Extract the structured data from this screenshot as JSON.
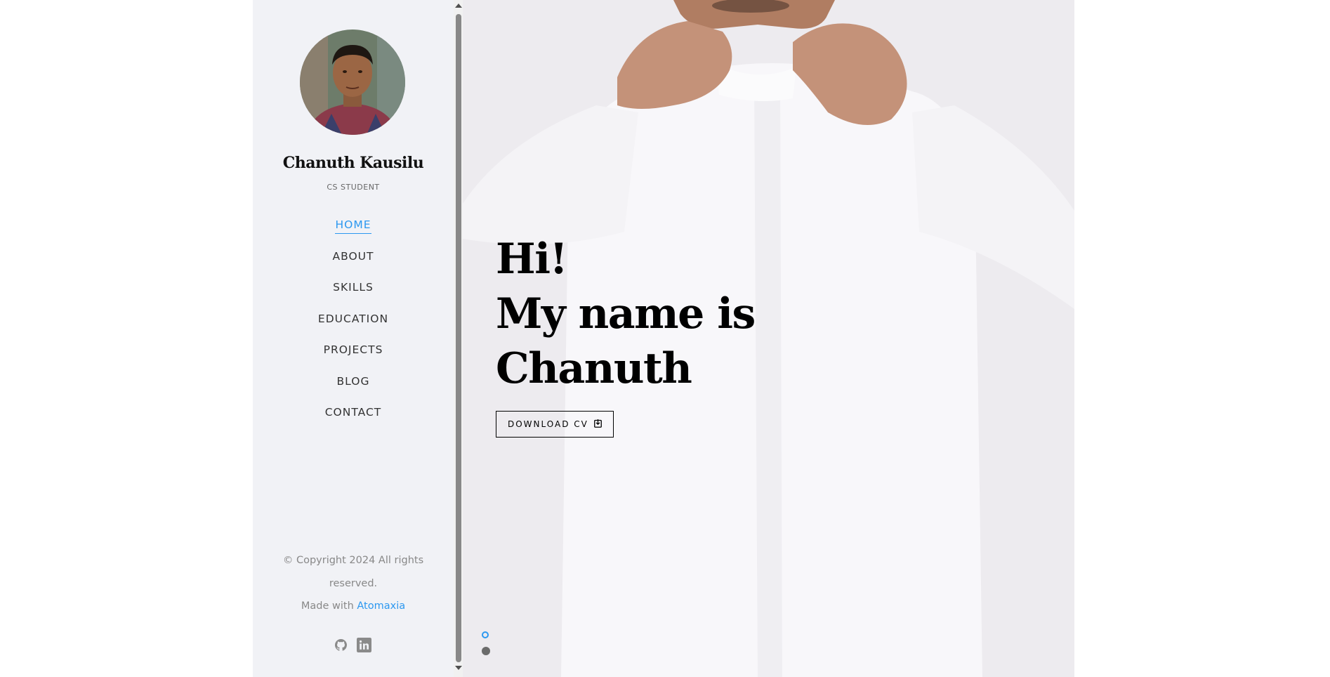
{
  "profile": {
    "name": "Chanuth Kausilu",
    "role": "CS STUDENT"
  },
  "nav": {
    "items": [
      {
        "label": "HOME",
        "active": true
      },
      {
        "label": "ABOUT"
      },
      {
        "label": "SKILLS"
      },
      {
        "label": "EDUCATION"
      },
      {
        "label": "PROJECTS"
      },
      {
        "label": "BLOG"
      },
      {
        "label": "CONTACT"
      }
    ]
  },
  "footer": {
    "copyright_line1": "© Copyright 2024 All rights",
    "copyright_line2": "reserved.",
    "made_with": "Made with",
    "made_with_link": "Atomaxia",
    "socials": [
      "github-icon",
      "linkedin-icon"
    ]
  },
  "hero": {
    "heading_line1": "Hi!",
    "heading_line2": "My name is",
    "heading_line3": "Chanuth",
    "button_label": "DOWNLOAD CV"
  },
  "carousel": {
    "slides": 2,
    "active_index": 0
  },
  "colors": {
    "accent": "#2c98f0",
    "sidebar_bg": "#f1f2f6",
    "text": "#333333"
  }
}
